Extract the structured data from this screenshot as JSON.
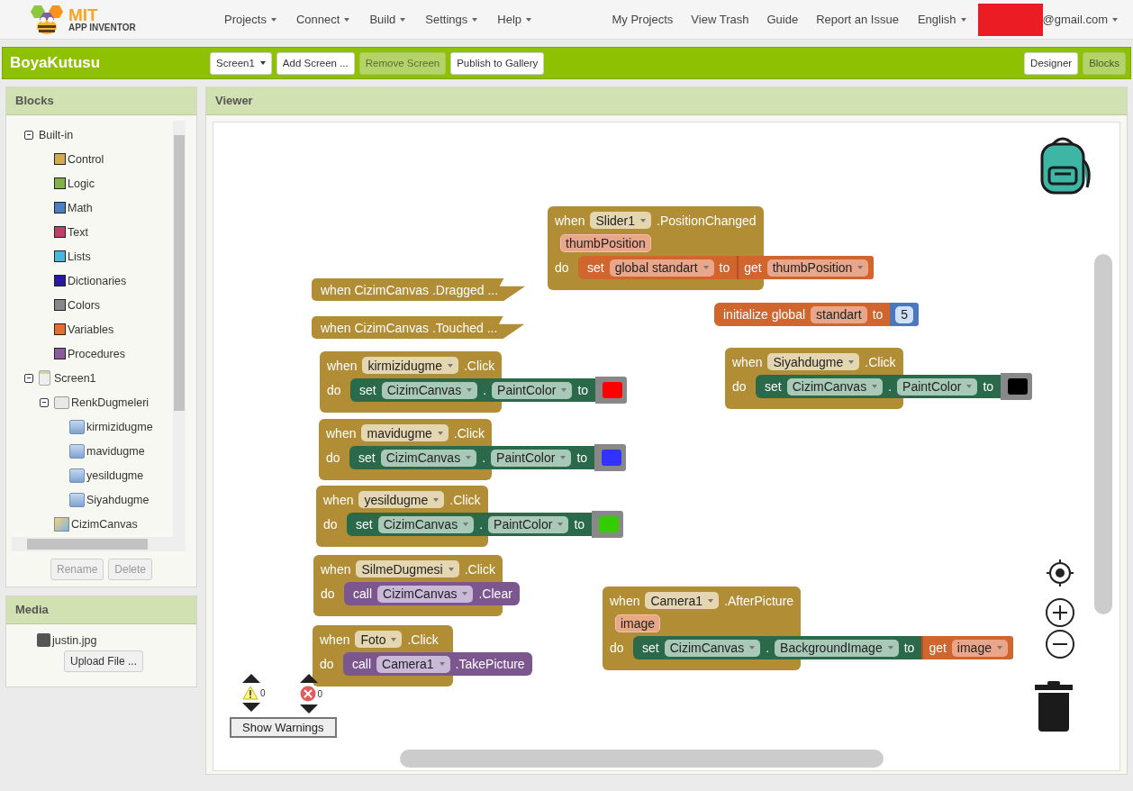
{
  "nav": {
    "logo": {
      "title": "MIT",
      "subtitle": "APP INVENTOR"
    },
    "menus": [
      "Projects",
      "Connect",
      "Build",
      "Settings",
      "Help"
    ],
    "links": [
      "My Projects",
      "View Trash",
      "Guide",
      "Report an Issue"
    ],
    "language": "English",
    "account": "@gmail.com"
  },
  "toolbar": {
    "project": "BoyaKutusu",
    "buttons": [
      {
        "label": "Screen1",
        "kind": "dropdown",
        "disabled": false
      },
      {
        "label": "Add Screen ...",
        "kind": "button",
        "disabled": false
      },
      {
        "label": "Remove Screen",
        "kind": "button",
        "disabled": true
      },
      {
        "label": "Publish to Gallery",
        "kind": "button",
        "disabled": false
      }
    ],
    "views": [
      {
        "label": "Designer",
        "selected": false
      },
      {
        "label": "Blocks",
        "selected": true
      }
    ]
  },
  "blocks_panel": {
    "title": "Blocks",
    "tree": [
      {
        "label": "Built-in",
        "kind": "folder",
        "expanded": true,
        "children": [
          {
            "label": "Control",
            "kind": "category",
            "color": "#d4aa50"
          },
          {
            "label": "Logic",
            "kind": "category",
            "color": "#84b04a"
          },
          {
            "label": "Math",
            "kind": "category",
            "color": "#4a7fc1"
          },
          {
            "label": "Text",
            "kind": "category",
            "color": "#c23e6a"
          },
          {
            "label": "Lists",
            "kind": "category",
            "color": "#4ab6dc"
          },
          {
            "label": "Dictionaries",
            "kind": "category",
            "color": "#2a1a9a"
          },
          {
            "label": "Colors",
            "kind": "category",
            "color": "#888888"
          },
          {
            "label": "Variables",
            "kind": "category",
            "color": "#e07030"
          },
          {
            "label": "Procedures",
            "kind": "category",
            "color": "#8a5c9c"
          }
        ]
      },
      {
        "label": "Screen1",
        "kind": "screen",
        "expanded": true,
        "children": [
          {
            "label": "RenkDugmeleri",
            "kind": "arrangement",
            "expanded": true,
            "children": [
              {
                "label": "kirmizidugme",
                "kind": "button"
              },
              {
                "label": "mavidugme",
                "kind": "button"
              },
              {
                "label": "yesildugme",
                "kind": "button"
              },
              {
                "label": "Siyahdugme",
                "kind": "button"
              }
            ]
          },
          {
            "label": "CizimCanvas",
            "kind": "canvas"
          }
        ]
      }
    ],
    "buttons": [
      {
        "label": "Rename",
        "disabled": true
      },
      {
        "label": "Delete",
        "disabled": true
      }
    ]
  },
  "media": {
    "title": "Media",
    "files": [
      "justin.jpg"
    ],
    "upload": "Upload File ..."
  },
  "viewer": {
    "title": "Viewer",
    "blocks": [
      {
        "kind": "event",
        "when": "when",
        "component": "Slider1",
        "event": ".PositionChanged",
        "params": [
          "thumbPosition"
        ],
        "do": "do",
        "statement": {
          "kind": "set_global",
          "set": "set",
          "variable": "global standart",
          "to": "to",
          "value": {
            "kind": "get",
            "get": "get",
            "variable": "thumbPosition"
          }
        }
      },
      {
        "kind": "collapsed_event",
        "when": "when",
        "component": "CizimCanvas",
        "event": ".Dragged ..."
      },
      {
        "kind": "collapsed_event",
        "when": "when",
        "component": "CizimCanvas",
        "event": ".Touched ..."
      },
      {
        "kind": "global_init",
        "label": "initialize global",
        "name": "standart",
        "to": "to",
        "value": {
          "kind": "number",
          "text": "5"
        }
      },
      {
        "kind": "event",
        "when": "when",
        "component": "kirmizidugme",
        "event": ".Click",
        "do": "do",
        "statement": {
          "kind": "set_property",
          "set": "set",
          "component": "CizimCanvas",
          "dot": ".",
          "property": "PaintColor",
          "to": "to",
          "value": {
            "kind": "color",
            "color": "#ff0000"
          }
        }
      },
      {
        "kind": "event",
        "when": "when",
        "component": "Siyahdugme",
        "event": ".Click",
        "do": "do",
        "statement": {
          "kind": "set_property",
          "set": "set",
          "component": "CizimCanvas",
          "dot": ".",
          "property": "PaintColor",
          "to": "to",
          "value": {
            "kind": "color",
            "color": "#000000"
          }
        }
      },
      {
        "kind": "event",
        "when": "when",
        "component": "mavidugme",
        "event": ".Click",
        "do": "do",
        "statement": {
          "kind": "set_property",
          "set": "set",
          "component": "CizimCanvas",
          "dot": ".",
          "property": "PaintColor",
          "to": "to",
          "value": {
            "kind": "color",
            "color": "#3333ff"
          }
        }
      },
      {
        "kind": "event",
        "when": "when",
        "component": "yesildugme",
        "event": ".Click",
        "do": "do",
        "statement": {
          "kind": "set_property",
          "set": "set",
          "component": "CizimCanvas",
          "dot": ".",
          "property": "PaintColor",
          "to": "to",
          "value": {
            "kind": "color",
            "color": "#33cc00"
          }
        }
      },
      {
        "kind": "event",
        "when": "when",
        "component": "SilmeDugmesi",
        "event": ".Click",
        "do": "do",
        "statement": {
          "kind": "call",
          "call": "call",
          "component": "CizimCanvas",
          "method": ".Clear"
        }
      },
      {
        "kind": "event",
        "when": "when",
        "component": "Foto",
        "event": ".Click",
        "do": "do",
        "statement": {
          "kind": "call",
          "call": "call",
          "component": "Camera1",
          "method": ".TakePicture"
        }
      },
      {
        "kind": "event",
        "when": "when",
        "component": "Camera1",
        "event": ".AfterPicture",
        "params": [
          "image"
        ],
        "do": "do",
        "statement": {
          "kind": "set_property",
          "set": "set",
          "component": "CizimCanvas",
          "dot": ".",
          "property": "BackgroundImage",
          "to": "to",
          "value": {
            "kind": "get",
            "get": "get",
            "variable": "image"
          }
        }
      }
    ],
    "warnings": {
      "warning_count": "0",
      "error_count": "0",
      "button": "Show Warnings"
    }
  }
}
